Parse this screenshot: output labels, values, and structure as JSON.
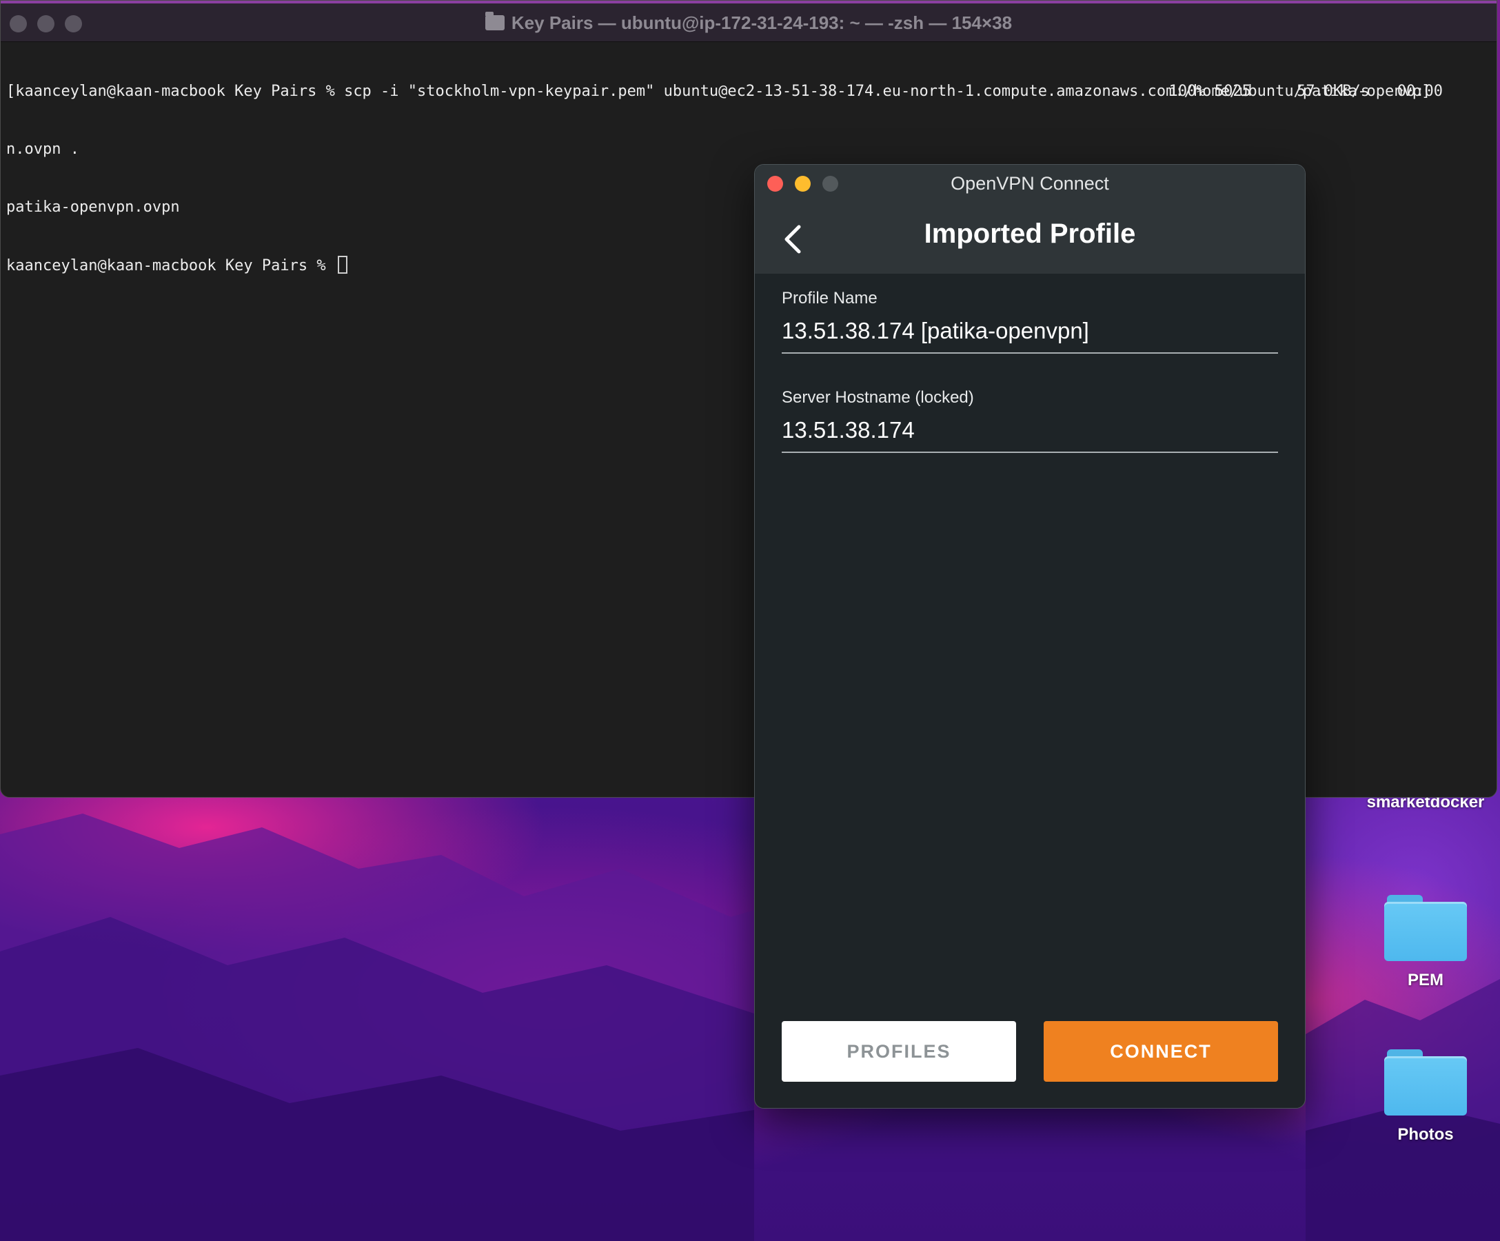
{
  "terminal": {
    "title": "Key Pairs — ubuntu@ip-172-31-24-193: ~ — -zsh — 154×38",
    "lines": [
      "[kaanceylan@kaan-macbook Key Pairs % scp -i \"stockholm-vpn-keypair.pem\" ubuntu@ec2-13-51-38-174.eu-north-1.compute.amazonaws.com:/home/ubuntu/patika-openvp]",
      "n.ovpn .",
      "patika-openvpn.ovpn",
      "kaanceylan@kaan-macbook Key Pairs % "
    ],
    "transfer_stats": "100% 5025     57.0KB/s   00:00"
  },
  "desktop": {
    "icons": [
      {
        "label": "smarketdocker",
        "icon": "folder-icon"
      },
      {
        "label": "PEM",
        "icon": "folder-icon"
      },
      {
        "label": "Photos",
        "icon": "folder-icon"
      }
    ]
  },
  "openvpn": {
    "window_title": "OpenVPN Connect",
    "header_title": "Imported Profile",
    "profile_name": {
      "label": "Profile Name",
      "value": "13.51.38.174 [patika-openvpn]"
    },
    "server_hostname": {
      "label": "Server Hostname (locked)",
      "value": "13.51.38.174"
    },
    "buttons": {
      "profiles": "PROFILES",
      "connect": "CONNECT"
    },
    "colors": {
      "connect": "#ef8120",
      "background": "#1e2427",
      "header": "#2f3538"
    }
  }
}
